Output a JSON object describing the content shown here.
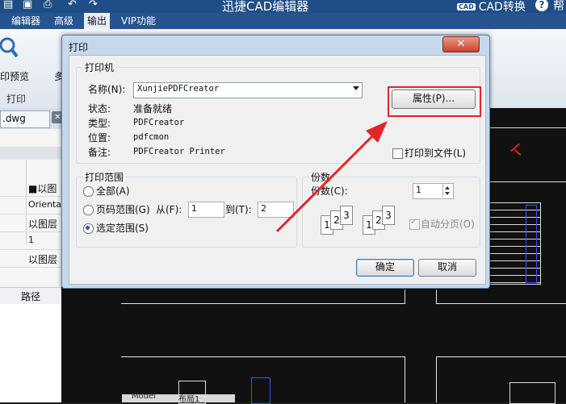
{
  "app": {
    "title": "迅捷CAD编辑器",
    "cad_convert_badge": "CAD",
    "cad_convert_label": "CAD转换",
    "help_partial": "帮"
  },
  "menubar": {
    "items": [
      {
        "label": "编辑器"
      },
      {
        "label": "高级"
      },
      {
        "label": "输出"
      },
      {
        "label": "VIP功能"
      }
    ]
  },
  "ribbon": {
    "preview_label": "印预览",
    "partial_label": "多",
    "group_label": "打印"
  },
  "doc_tab": {
    "label": ".dwg",
    "close": "✕"
  },
  "left_panel": {
    "rows": [
      {
        "label": "■以图"
      },
      {
        "label": "Orientati"
      },
      {
        "label": "以图层"
      },
      {
        "label": "1"
      },
      {
        "label": "以图层"
      }
    ],
    "path_header": "路径"
  },
  "canvas": {
    "tabs": [
      {
        "label": "Model"
      },
      {
        "label": "布局1"
      }
    ]
  },
  "dialog": {
    "title": "打印",
    "close": "✕",
    "printer_group": "打印机",
    "name_label": "名称(N):",
    "printer_value": "XunjiePDFCreator",
    "properties_button": "属性(P)...",
    "status_label": "状态:",
    "status_value": "准备就绪",
    "type_label": "类型:",
    "type_value": "PDFCreator",
    "where_label": "位置:",
    "where_value": "pdfcmon",
    "comment_label": "备注:",
    "comment_value": "PDFCreator Printer",
    "print_to_file": "打印到文件(L)",
    "range_group": "打印范围",
    "range_all": "全部(A)",
    "range_pages": "页码范围(G)",
    "from_label": "从(F):",
    "from_value": "1",
    "to_label": "到(T):",
    "to_value": "2",
    "range_selection": "选定范围(S)",
    "selected_range": "selection",
    "copies_group": "份数",
    "copies_label": "份数(C):",
    "copies_value": "1",
    "collate_label": "自动分页(O)",
    "collate_checked": true,
    "collate_pages": [
      "1",
      "2",
      "3"
    ],
    "ok_button": "确定",
    "cancel_button": "取消"
  },
  "colors": {
    "title_bar": "#1f4e86",
    "highlight": "#e2252b",
    "annotation_arrow": "#e2252b"
  }
}
